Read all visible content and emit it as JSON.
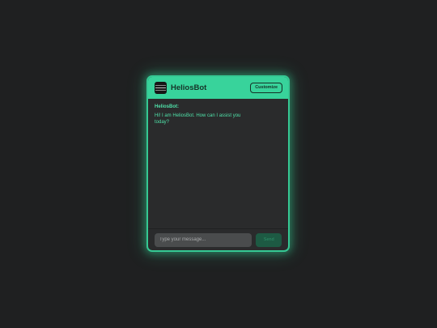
{
  "header": {
    "bot_name": "HeliosBot",
    "customize_label": "Customize",
    "avatar_icon": "robot-avatar-icon"
  },
  "messages": [
    {
      "sender": "HeliosBot:",
      "text": "Hi! I am HeliosBot. How can I assist you today?"
    }
  ],
  "composer": {
    "placeholder": "Type your message...",
    "value": "",
    "send_label": "Send"
  },
  "colors": {
    "accent": "#38d39b",
    "background": "#1f2021",
    "panel": "#2a2b2c",
    "send_button": "#1d5a43"
  }
}
